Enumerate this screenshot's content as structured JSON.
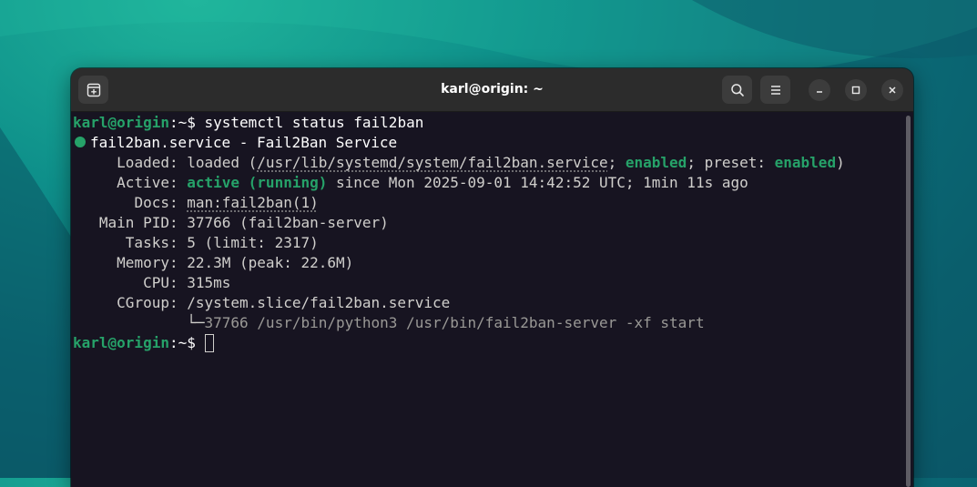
{
  "window": {
    "title": "karl@origin: ~"
  },
  "titlebar": {
    "new_tab_icon": "new-tab-icon",
    "search_icon": "search-icon",
    "menu_icon": "hamburger-menu-icon",
    "minimize_icon": "minimize-icon",
    "maximize_icon": "maximize-icon",
    "close_icon": "close-icon"
  },
  "colors": {
    "prompt_green": "#26a269",
    "terminal_bg": "#171421",
    "titlebar_bg": "#2c2c2c"
  },
  "terminal": {
    "prompt": {
      "user_host": "karl@origin",
      "sep": ":",
      "path": "~",
      "symbol": "$ "
    },
    "command": "systemctl status fail2ban",
    "header": "fail2ban.service - Fail2Ban Service",
    "loaded": {
      "label": "Loaded: ",
      "prefix": "loaded (",
      "path": "/usr/lib/systemd/system/fail2ban.service",
      "sep1": "; ",
      "enabled": "enabled",
      "sep2": "; preset: ",
      "preset": "enabled",
      "suffix": ")"
    },
    "active": {
      "label": "Active: ",
      "state": "active (running)",
      "since": " since Mon 2025-09-01 14:42:52 UTC; 1min 11s ago"
    },
    "docs": {
      "label": "Docs: ",
      "value": "man:fail2ban(1)"
    },
    "main_pid": {
      "label": "Main PID: ",
      "value": "37766 (fail2ban-server)"
    },
    "tasks": {
      "label": "Tasks: ",
      "value": "5 (limit: 2317)"
    },
    "memory": {
      "label": "Memory: ",
      "value": "22.3M (peak: 22.6M)"
    },
    "cpu": {
      "label": "CPU: ",
      "value": "315ms"
    },
    "cgroup": {
      "label": "CGroup: ",
      "value": "/system.slice/fail2ban.service"
    },
    "process": {
      "tree": "└─",
      "value": "37766 /usr/bin/python3 /usr/bin/fail2ban-server -xf start"
    }
  }
}
